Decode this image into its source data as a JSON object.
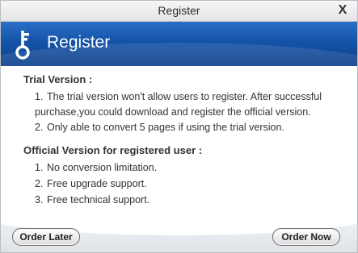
{
  "window": {
    "title": "Register",
    "close_glyph": "X"
  },
  "banner": {
    "icon": "key-icon",
    "heading": "Register"
  },
  "trial": {
    "title": "Trial Version :",
    "items": [
      {
        "num": "1.",
        "text": "The trial version won't allow users to register. After successful purchase,you could download and register the official version."
      },
      {
        "num": "2.",
        "text": "Only able to convert 5 pages if using the trial version."
      }
    ]
  },
  "official": {
    "title": "Official Version for registered user :",
    "items": [
      {
        "num": "1.",
        "text": "No conversion limitation."
      },
      {
        "num": "2.",
        "text": "Free upgrade support."
      },
      {
        "num": "3.",
        "text": "Free technical support."
      }
    ]
  },
  "footer": {
    "order_later_label": "Order Later",
    "order_now_label": "Order Now"
  },
  "colors": {
    "banner_top": "#2a6fc6",
    "banner_bottom": "#0b3f8a",
    "text": "#333333"
  }
}
